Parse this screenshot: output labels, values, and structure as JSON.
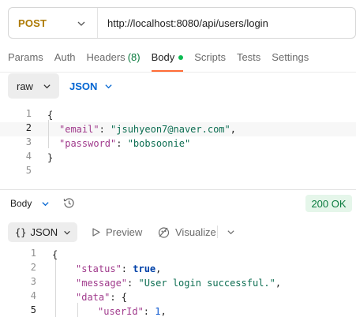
{
  "request": {
    "method": "POST",
    "url": "http://localhost:8080/api/users/login"
  },
  "tabs": [
    {
      "label": "Params"
    },
    {
      "label": "Auth"
    },
    {
      "label": "Headers",
      "count": "(8)"
    },
    {
      "label": "Body",
      "active": true
    },
    {
      "label": "Scripts"
    },
    {
      "label": "Tests"
    },
    {
      "label": "Settings"
    }
  ],
  "body_mode": {
    "type": "raw",
    "language": "JSON"
  },
  "request_body": {
    "line_numbers": [
      "1",
      "2",
      "3",
      "4",
      "5"
    ],
    "open": "{",
    "email_key": "\"email\"",
    "email_value": "\"jsuhyeon7@naver.com\"",
    "password_key": "\"password\"",
    "password_value": "\"bobsoonie\"",
    "close": "}"
  },
  "response": {
    "section_label": "Body",
    "status": "200 OK",
    "format": "JSON",
    "preview_label": "Preview",
    "visualize_label": "Visualize",
    "line_numbers": [
      "1",
      "2",
      "3",
      "4",
      "5"
    ],
    "open": "{",
    "status_key": "\"status\"",
    "status_value": "true",
    "message_key": "\"message\"",
    "message_value": "\"User login successful.\"",
    "data_key": "\"data\"",
    "userid_key": "\"userId\"",
    "userid_value": "1"
  },
  "icons": {
    "method_dropdown": "chevron-down-icon",
    "history": "history-icon",
    "preview": "play-icon",
    "visualize": "visualize-icon"
  },
  "colors": {
    "method": "#ad7a03",
    "active_tab": "#ff6c37",
    "body_dot": "#0cbb52",
    "json_lang": "#0265d2",
    "status_ok_bg": "#e5f6ea",
    "status_ok_text": "#0a7b3e"
  }
}
